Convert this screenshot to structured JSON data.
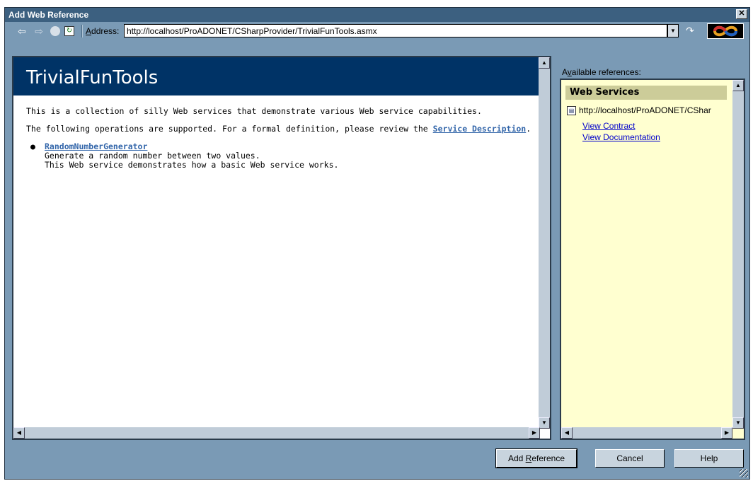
{
  "window": {
    "title": "Add Web Reference",
    "close_label": "✕"
  },
  "toolbar": {
    "address_label_prefix": "",
    "address_label_accel": "A",
    "address_label_rest": "ddress:",
    "address_value": "http://localhost/ProADONET/CSharpProvider/TrivialFunTools.asmx"
  },
  "page": {
    "title": "TrivialFunTools",
    "intro": "This is a collection of silly Web services that demonstrate various Web service capabilities.",
    "ops_text": "The following operations are supported. For a formal definition, please review the ",
    "service_description_link": "Service Description",
    "ops_text_end": ".",
    "operations": [
      {
        "name": "RandomNumberGenerator",
        "line1": "Generate a random number between two values.",
        "line2": "This Web service demonstrates how a basic Web service works."
      }
    ]
  },
  "side": {
    "label_prefix": "A",
    "label_accel": "v",
    "label_rest": "ailable references:",
    "header": "Web Services",
    "item_url": "http://localhost/ProADONET/CShar",
    "link_contract": "View Contract",
    "link_documentation": "View Documentation"
  },
  "buttons": {
    "add_reference_prefix": "Add ",
    "add_reference_accel": "R",
    "add_reference_rest": "eference",
    "cancel": "Cancel",
    "help": "Help"
  },
  "icons": [
    "back-arrow-icon",
    "forward-arrow-icon",
    "stop-icon",
    "refresh-icon",
    "go-icon",
    "app-logo-icon",
    "web-service-icon",
    "resize-grip-icon"
  ]
}
